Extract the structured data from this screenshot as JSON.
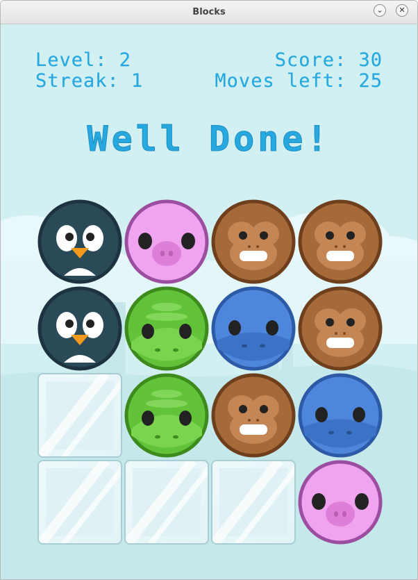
{
  "window": {
    "title": "Blocks"
  },
  "hud": {
    "level": "Level: 2",
    "streak": "Streak: 1",
    "score": "Score: 30",
    "moves": "Moves left: 25"
  },
  "banner": "Well Done!",
  "board": {
    "rows": [
      [
        "penguin",
        "pig",
        "monkey",
        "monkey"
      ],
      [
        "penguin",
        "frog",
        "hippo",
        "monkey"
      ],
      [
        "ice",
        "frog",
        "monkey",
        "hippo"
      ],
      [
        "ice",
        "ice",
        "ice",
        "pig"
      ]
    ]
  },
  "colors": {
    "text": "#27a9e0",
    "background": "#d2f0f2",
    "penguin": "#2b4a58",
    "pig": "#f0a3ee",
    "monkey": "#a5693a",
    "frog": "#62c23a",
    "hippo": "#4e86dc"
  }
}
